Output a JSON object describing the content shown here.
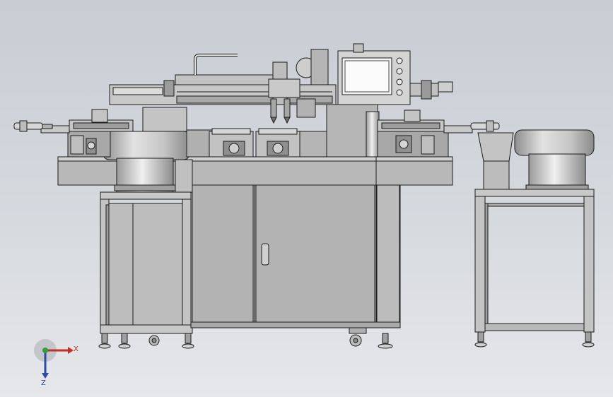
{
  "scene": {
    "kind": "cad-3d-viewport",
    "background_top": "#c9ccd3",
    "background_bottom": "#e6e7ea",
    "model_fill": "#b9b9b9",
    "model_fill_light": "#d2d2d2",
    "model_fill_dark": "#8e8e8e",
    "edge_color": "#1c1c1c",
    "screen_color": "#f2f2f2"
  },
  "triad": {
    "x_label": "X",
    "z_label": "Z",
    "x_color": "#c0302a",
    "y_color": "#2fa03a",
    "z_color": "#2a4aa8"
  }
}
